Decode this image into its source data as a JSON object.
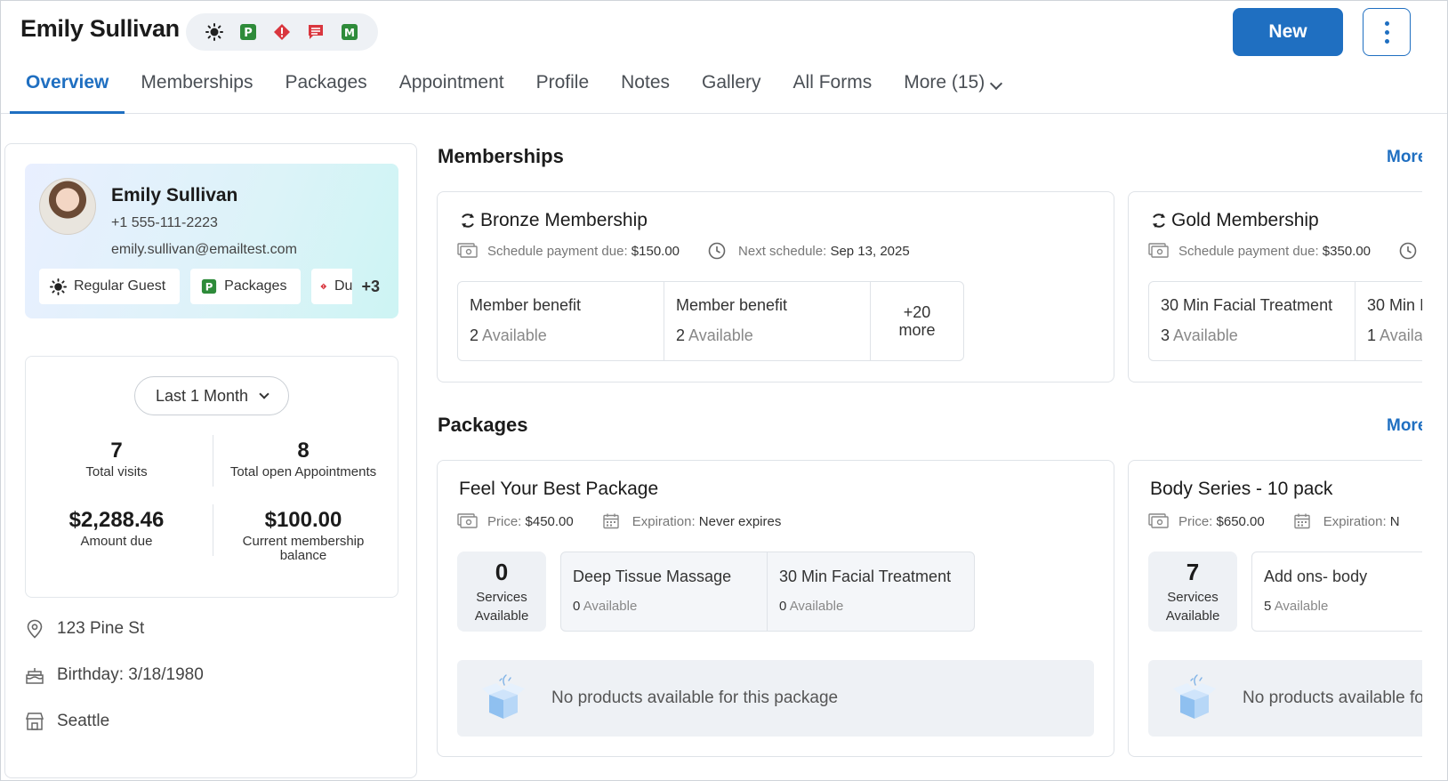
{
  "header": {
    "client_name": "Emily Sullivan",
    "new_label": "New",
    "tag_icons": [
      "sun-icon",
      "packages-p-icon",
      "alert-diamond-icon",
      "message-icon",
      "membership-m-icon"
    ]
  },
  "tabs": [
    {
      "label": "Overview",
      "active": true
    },
    {
      "label": "Memberships"
    },
    {
      "label": "Packages"
    },
    {
      "label": "Appointment"
    },
    {
      "label": "Profile"
    },
    {
      "label": "Notes"
    },
    {
      "label": "Gallery"
    },
    {
      "label": "All Forms"
    },
    {
      "label": "More (15)"
    }
  ],
  "profile": {
    "name": "Emily Sullivan",
    "phone": "+1 555-111-2223",
    "email": "emily.sullivan@emailtest.com",
    "chips": [
      {
        "label": "Regular Guest",
        "icon": "sun-icon"
      },
      {
        "label": "Packages",
        "icon": "packages-p-icon"
      },
      {
        "label": "Du",
        "icon": "alert-diamond-icon"
      }
    ],
    "more_chips": "+3"
  },
  "stats": {
    "range": "Last 1 Month",
    "total_visits": {
      "value": "7",
      "label": "Total visits"
    },
    "open_appointments": {
      "value": "8",
      "label": "Total open Appointments"
    },
    "amount_due": {
      "value": "$2,288.46",
      "label": "Amount due"
    },
    "membership_balance": {
      "value": "$100.00",
      "label": "Current membership balance"
    }
  },
  "info": {
    "address": "123 Pine St",
    "birthday": "Birthday: 3/18/1980",
    "location": "Seattle"
  },
  "memberships": {
    "title": "Memberships",
    "more": "More",
    "cards": [
      {
        "name": "Bronze Membership",
        "payment_label": "Schedule payment due:",
        "payment_value": "$150.00",
        "next_label": "Next schedule:",
        "next_value": "Sep 13, 2025",
        "benefits": [
          {
            "name": "Member benefit",
            "count": "2",
            "suffix": "Available"
          },
          {
            "name": "Member benefit",
            "count": "2",
            "suffix": "Available"
          }
        ],
        "more_benefits": "+20 more"
      },
      {
        "name": "Gold Membership",
        "payment_label": "Schedule payment due:",
        "payment_value": "$350.00",
        "benefits": [
          {
            "name": "30 Min Facial Treatment",
            "count": "3",
            "suffix": "Available"
          },
          {
            "name": "30 Min I",
            "count": "1",
            "suffix": "Availa"
          }
        ]
      }
    ]
  },
  "packages": {
    "title": "Packages",
    "more": "More",
    "cards": [
      {
        "name": "Feel Your Best Package",
        "price_label": "Price:",
        "price_value": "$450.00",
        "exp_label": "Expiration:",
        "exp_value": "Never expires",
        "services_count": "0",
        "services_label": "Services Available",
        "services": [
          {
            "name": "Deep Tissue Massage",
            "count": "0",
            "suffix": "Available"
          },
          {
            "name": "30 Min Facial Treatment",
            "count": "0",
            "suffix": "Available"
          }
        ],
        "no_products": "No products available for this package"
      },
      {
        "name": "Body Series - 10 pack",
        "price_label": "Price:",
        "price_value": "$650.00",
        "exp_label": "Expiration:",
        "exp_value": "N",
        "services_count": "7",
        "services_label": "Services Available",
        "services": [
          {
            "name": "Add ons- body",
            "count": "5",
            "suffix": "Available"
          }
        ],
        "no_products": "No products available for"
      }
    ]
  },
  "colors": {
    "accent": "#1f6fc1",
    "tag_green": "#2e8b3a",
    "tag_red": "#d9363e"
  }
}
